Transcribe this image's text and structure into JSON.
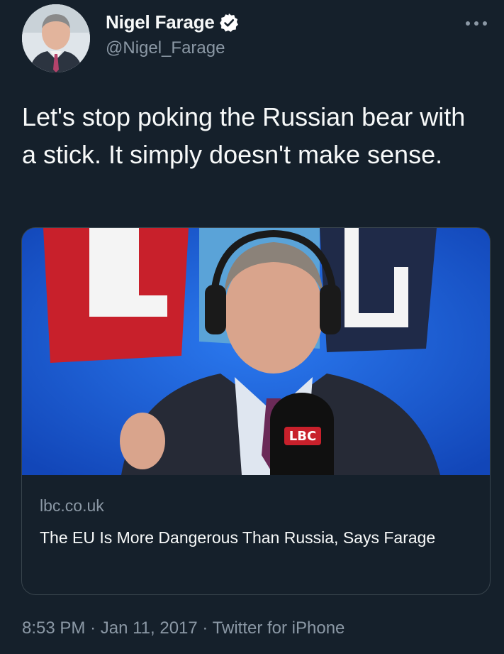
{
  "author": {
    "display_name": "Nigel Farage",
    "handle": "@Nigel_Farage",
    "verified": true
  },
  "tweet": {
    "text": "Let's stop poking the Russian bear with a stick. It simply doesn't make sense."
  },
  "card": {
    "image_label": "LBC",
    "domain": "lbc.co.uk",
    "title": "The EU Is More Dangerous Than Russia, Says Farage"
  },
  "meta": {
    "time": "8:53 PM",
    "separator": "·",
    "date": "Jan 11, 2017",
    "source": "Twitter for iPhone"
  },
  "icons": {
    "more": "more-horizontal-icon",
    "verified": "verified-badge-icon"
  },
  "colors": {
    "background": "#15202b",
    "text_primary": "#f7f9f9",
    "text_secondary": "#8b98a5",
    "verified_badge": "#ffffff",
    "card_border": "#38444d",
    "lbc_red": "#c8202b",
    "lbc_blue": "#1b5fd6"
  }
}
